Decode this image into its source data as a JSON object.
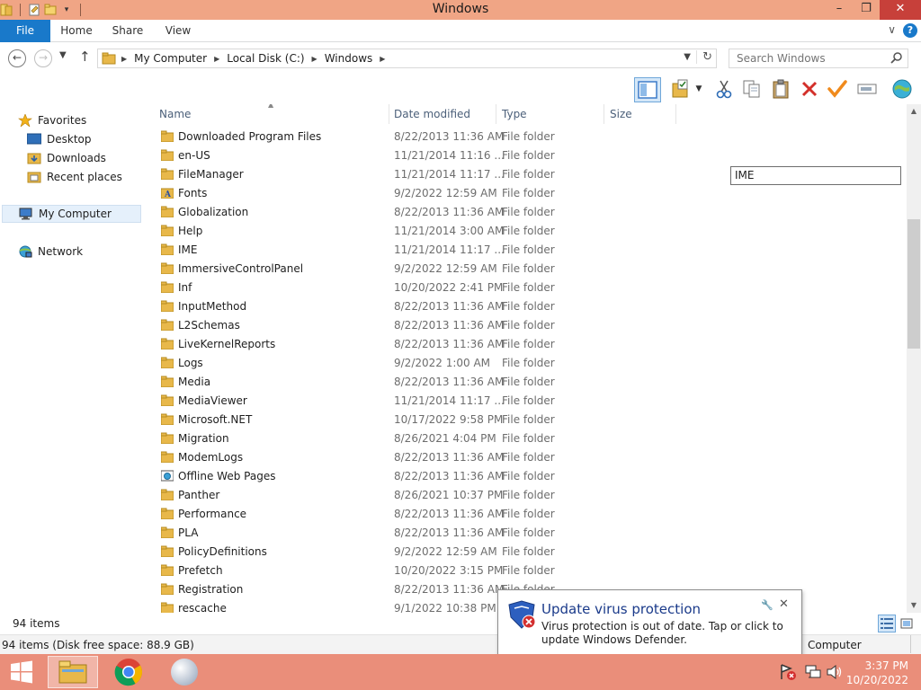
{
  "window": {
    "title": "Windows",
    "minimize": "–",
    "restore": "❐",
    "close": "✕"
  },
  "ribbon": {
    "tabs": [
      "File",
      "Home",
      "Share",
      "View"
    ],
    "expand_icon": "∨",
    "help_icon": "?"
  },
  "navigation": {
    "breadcrumbs": [
      "My Computer",
      "Local Disk (C:)",
      "Windows"
    ],
    "search_placeholder": "Search Windows"
  },
  "nav_pane": {
    "favorites": "Favorites",
    "desktop": "Desktop",
    "downloads": "Downloads",
    "recent": "Recent places",
    "computer": "My Computer",
    "network": "Network"
  },
  "columns": {
    "name": "Name",
    "date": "Date modified",
    "type": "Type",
    "size": "Size"
  },
  "files": [
    {
      "name": "Downloaded Program Files",
      "date": "8/22/2013 11:36 AM",
      "type": "File folder",
      "icon": "folder"
    },
    {
      "name": "en-US",
      "date": "11/21/2014 11:16 ...",
      "type": "File folder",
      "icon": "folder"
    },
    {
      "name": "FileManager",
      "date": "11/21/2014 11:17 ...",
      "type": "File folder",
      "icon": "folder"
    },
    {
      "name": "Fonts",
      "date": "9/2/2022 12:59 AM",
      "type": "File folder",
      "icon": "fonts-folder"
    },
    {
      "name": "Globalization",
      "date": "8/22/2013 11:36 AM",
      "type": "File folder",
      "icon": "folder"
    },
    {
      "name": "Help",
      "date": "11/21/2014 3:00 AM",
      "type": "File folder",
      "icon": "folder"
    },
    {
      "name": "IME",
      "date": "11/21/2014 11:17 ...",
      "type": "File folder",
      "icon": "folder"
    },
    {
      "name": "ImmersiveControlPanel",
      "date": "9/2/2022 12:59 AM",
      "type": "File folder",
      "icon": "folder"
    },
    {
      "name": "Inf",
      "date": "10/20/2022 2:41 PM",
      "type": "File folder",
      "icon": "folder"
    },
    {
      "name": "InputMethod",
      "date": "8/22/2013 11:36 AM",
      "type": "File folder",
      "icon": "folder"
    },
    {
      "name": "L2Schemas",
      "date": "8/22/2013 11:36 AM",
      "type": "File folder",
      "icon": "folder"
    },
    {
      "name": "LiveKernelReports",
      "date": "8/22/2013 11:36 AM",
      "type": "File folder",
      "icon": "folder"
    },
    {
      "name": "Logs",
      "date": "9/2/2022 1:00 AM",
      "type": "File folder",
      "icon": "folder"
    },
    {
      "name": "Media",
      "date": "8/22/2013 11:36 AM",
      "type": "File folder",
      "icon": "folder"
    },
    {
      "name": "MediaViewer",
      "date": "11/21/2014 11:17 ...",
      "type": "File folder",
      "icon": "folder"
    },
    {
      "name": "Microsoft.NET",
      "date": "10/17/2022 9:58 PM",
      "type": "File folder",
      "icon": "folder"
    },
    {
      "name": "Migration",
      "date": "8/26/2021 4:04 PM",
      "type": "File folder",
      "icon": "folder"
    },
    {
      "name": "ModemLogs",
      "date": "8/22/2013 11:36 AM",
      "type": "File folder",
      "icon": "folder"
    },
    {
      "name": "Offline Web Pages",
      "date": "8/22/2013 11:36 AM",
      "type": "File folder",
      "icon": "offline-pages-folder"
    },
    {
      "name": "Panther",
      "date": "8/26/2021 10:37 PM",
      "type": "File folder",
      "icon": "folder"
    },
    {
      "name": "Performance",
      "date": "8/22/2013 11:36 AM",
      "type": "File folder",
      "icon": "folder"
    },
    {
      "name": "PLA",
      "date": "8/22/2013 11:36 AM",
      "type": "File folder",
      "icon": "folder"
    },
    {
      "name": "PolicyDefinitions",
      "date": "9/2/2022 12:59 AM",
      "type": "File folder",
      "icon": "folder"
    },
    {
      "name": "Prefetch",
      "date": "10/20/2022 3:15 PM",
      "type": "File folder",
      "icon": "folder"
    },
    {
      "name": "Registration",
      "date": "8/22/2013 11:36 AM",
      "type": "File folder",
      "icon": "folder"
    },
    {
      "name": "rescache",
      "date": "9/1/2022 10:38 PM",
      "type": "File folder",
      "icon": "folder"
    }
  ],
  "rename_box": {
    "value": "IME"
  },
  "scrollbar": {
    "thumb_position": 0.21,
    "thumb_fraction": 0.27
  },
  "status": {
    "item_count": "94 items",
    "details": "94 items (Disk free space: 88.9 GB)",
    "location": "Computer"
  },
  "notification": {
    "title": "Update virus protection",
    "message": "Virus protection is out of date. Tap or click to update Windows Defender."
  },
  "clock": {
    "time": "3:37 PM",
    "date": "10/20/2022"
  },
  "colors": {
    "titlebar": "#f0a585",
    "taskbar": "#ea8e7a",
    "file_tab": "#1979ca",
    "folder": "#e8b84a"
  }
}
